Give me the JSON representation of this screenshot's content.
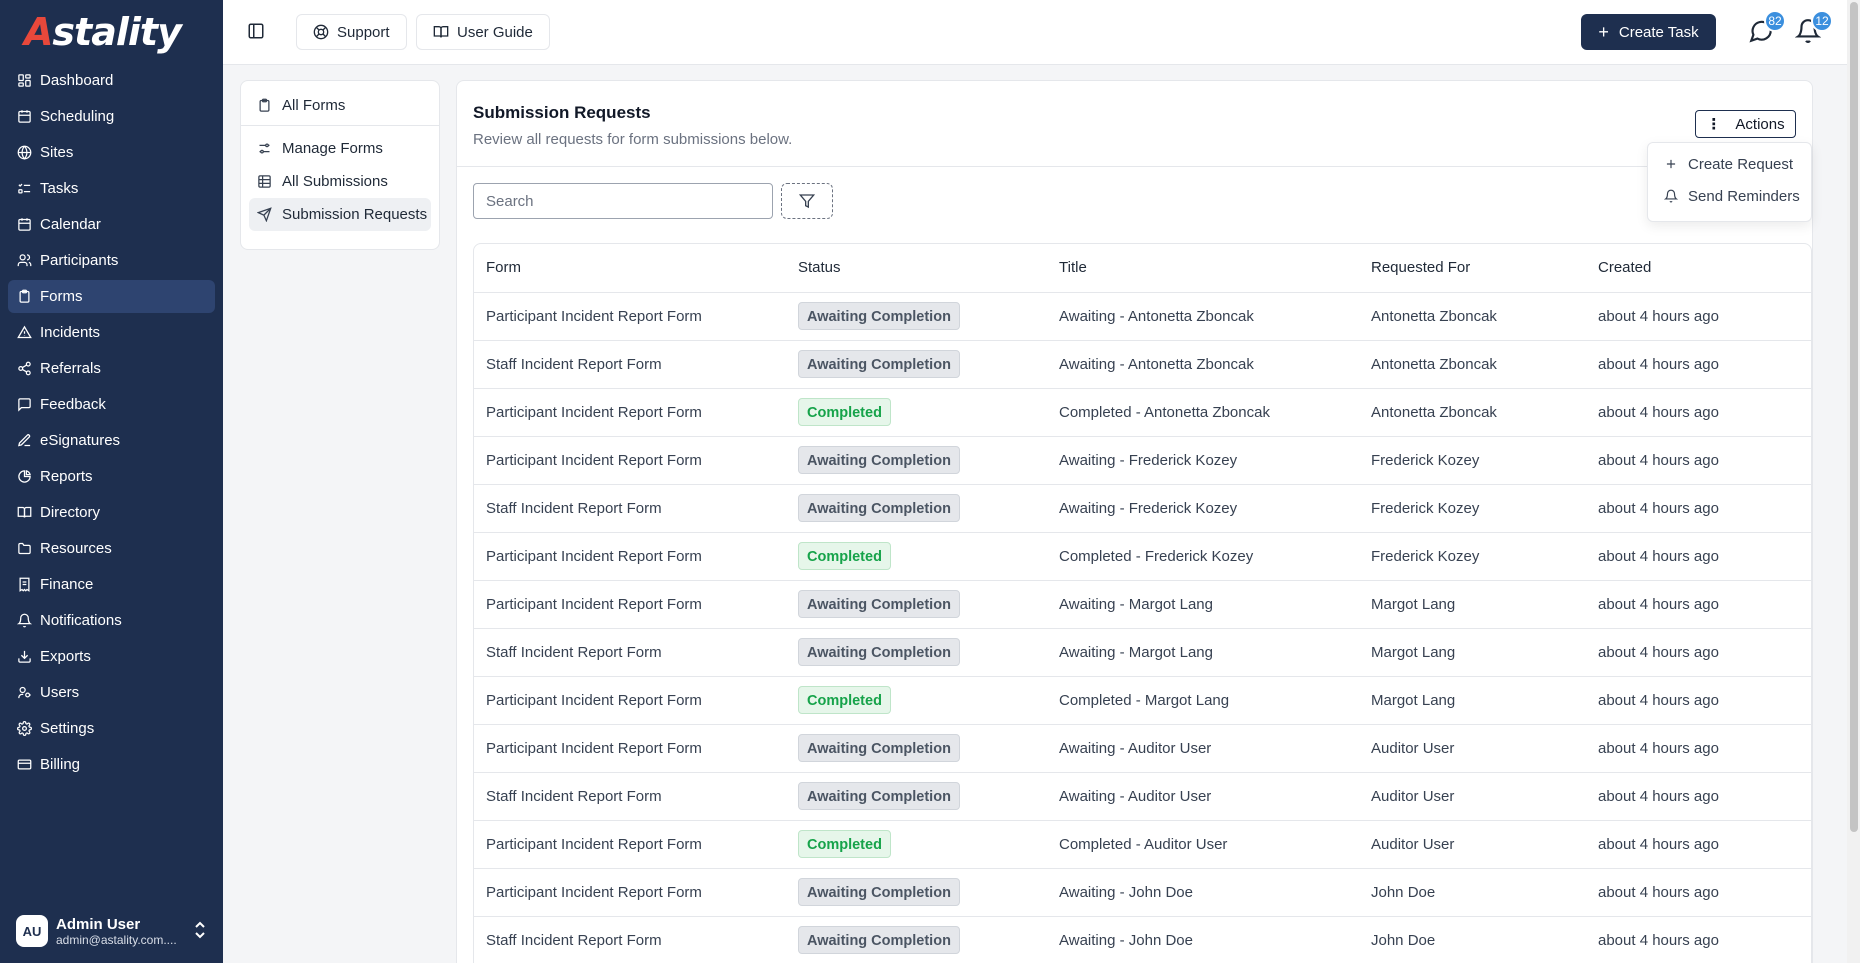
{
  "app": {
    "logo_text": "Astality",
    "brand_colors": {
      "sidebar": "#1e2f4f",
      "accent": "#e8483b",
      "badge": "#3b8fde"
    }
  },
  "sidebar": {
    "items": [
      {
        "label": "Dashboard",
        "icon": "dashboard-icon"
      },
      {
        "label": "Scheduling",
        "icon": "calendar-clock-icon"
      },
      {
        "label": "Sites",
        "icon": "globe-icon"
      },
      {
        "label": "Tasks",
        "icon": "list-todo-icon"
      },
      {
        "label": "Calendar",
        "icon": "calendar-icon"
      },
      {
        "label": "Participants",
        "icon": "users-icon"
      },
      {
        "label": "Forms",
        "icon": "clipboard-icon"
      },
      {
        "label": "Incidents",
        "icon": "warning-icon"
      },
      {
        "label": "Referrals",
        "icon": "share-icon"
      },
      {
        "label": "Feedback",
        "icon": "message-icon"
      },
      {
        "label": "eSignatures",
        "icon": "pen-icon"
      },
      {
        "label": "Reports",
        "icon": "pie-chart-icon"
      },
      {
        "label": "Directory",
        "icon": "book-icon"
      },
      {
        "label": "Resources",
        "icon": "folder-icon"
      },
      {
        "label": "Finance",
        "icon": "receipt-icon"
      },
      {
        "label": "Notifications",
        "icon": "bell-icon"
      },
      {
        "label": "Exports",
        "icon": "download-icon"
      },
      {
        "label": "Users",
        "icon": "user-key-icon"
      },
      {
        "label": "Settings",
        "icon": "gear-icon"
      },
      {
        "label": "Billing",
        "icon": "credit-card-icon"
      }
    ],
    "active": "Forms",
    "user": {
      "initials": "AU",
      "name": "Admin User",
      "email": "admin@astality.com...."
    }
  },
  "header": {
    "support_label": "Support",
    "guide_label": "User Guide",
    "create_task_label": "Create Task",
    "messages_count": "82",
    "notifications_count": "12"
  },
  "subnav": {
    "all_forms": "All Forms",
    "manage_forms": "Manage Forms",
    "all_submissions": "All Submissions",
    "submission_requests": "Submission Requests"
  },
  "main": {
    "title": "Submission Requests",
    "subtitle": "Review all requests for form submissions below.",
    "actions_label": "Actions",
    "search_placeholder": "Search",
    "dropdown": {
      "create_request": "Create Request",
      "send_reminders": "Send Reminders"
    }
  },
  "table": {
    "columns": [
      "Form",
      "Status",
      "Title",
      "Requested For",
      "Created"
    ],
    "rows": [
      {
        "form": "Participant Incident Report Form",
        "status": "Awaiting Completion",
        "title": "Awaiting - Antonetta Zboncak",
        "requested_for": "Antonetta Zboncak",
        "created": "about 4 hours ago"
      },
      {
        "form": "Staff Incident Report Form",
        "status": "Awaiting Completion",
        "title": "Awaiting - Antonetta Zboncak",
        "requested_for": "Antonetta Zboncak",
        "created": "about 4 hours ago"
      },
      {
        "form": "Participant Incident Report Form",
        "status": "Completed",
        "title": "Completed - Antonetta Zboncak",
        "requested_for": "Antonetta Zboncak",
        "created": "about 4 hours ago"
      },
      {
        "form": "Participant Incident Report Form",
        "status": "Awaiting Completion",
        "title": "Awaiting - Frederick Kozey",
        "requested_for": "Frederick Kozey",
        "created": "about 4 hours ago"
      },
      {
        "form": "Staff Incident Report Form",
        "status": "Awaiting Completion",
        "title": "Awaiting - Frederick Kozey",
        "requested_for": "Frederick Kozey",
        "created": "about 4 hours ago"
      },
      {
        "form": "Participant Incident Report Form",
        "status": "Completed",
        "title": "Completed - Frederick Kozey",
        "requested_for": "Frederick Kozey",
        "created": "about 4 hours ago"
      },
      {
        "form": "Participant Incident Report Form",
        "status": "Awaiting Completion",
        "title": "Awaiting - Margot Lang",
        "requested_for": "Margot Lang",
        "created": "about 4 hours ago"
      },
      {
        "form": "Staff Incident Report Form",
        "status": "Awaiting Completion",
        "title": "Awaiting - Margot Lang",
        "requested_for": "Margot Lang",
        "created": "about 4 hours ago"
      },
      {
        "form": "Participant Incident Report Form",
        "status": "Completed",
        "title": "Completed - Margot Lang",
        "requested_for": "Margot Lang",
        "created": "about 4 hours ago"
      },
      {
        "form": "Participant Incident Report Form",
        "status": "Awaiting Completion",
        "title": "Awaiting - Auditor User",
        "requested_for": "Auditor User",
        "created": "about 4 hours ago"
      },
      {
        "form": "Staff Incident Report Form",
        "status": "Awaiting Completion",
        "title": "Awaiting - Auditor User",
        "requested_for": "Auditor User",
        "created": "about 4 hours ago"
      },
      {
        "form": "Participant Incident Report Form",
        "status": "Completed",
        "title": "Completed - Auditor User",
        "requested_for": "Auditor User",
        "created": "about 4 hours ago"
      },
      {
        "form": "Participant Incident Report Form",
        "status": "Awaiting Completion",
        "title": "Awaiting - John Doe",
        "requested_for": "John Doe",
        "created": "about 4 hours ago"
      },
      {
        "form": "Staff Incident Report Form",
        "status": "Awaiting Completion",
        "title": "Awaiting - John Doe",
        "requested_for": "John Doe",
        "created": "about 4 hours ago"
      }
    ]
  }
}
